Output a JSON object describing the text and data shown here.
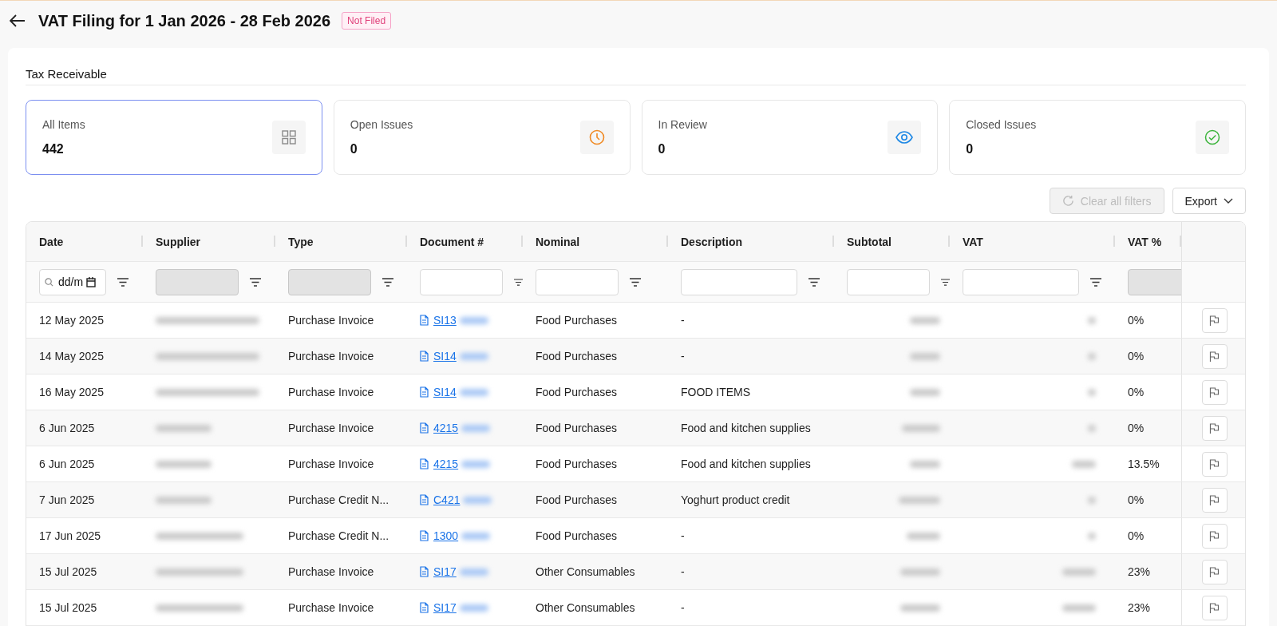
{
  "header": {
    "title": "VAT Filing for 1 Jan 2026 - 28 Feb 2026",
    "status": "Not Filed"
  },
  "section_title": "Tax Receivable",
  "cards": [
    {
      "label": "All Items",
      "count": "442",
      "selected": true,
      "kind": "grid"
    },
    {
      "label": "Open Issues",
      "count": "0",
      "selected": false,
      "kind": "clock"
    },
    {
      "label": "In Review",
      "count": "0",
      "selected": false,
      "kind": "eye"
    },
    {
      "label": "Closed Issues",
      "count": "0",
      "selected": false,
      "kind": "check"
    }
  ],
  "toolbar": {
    "clear_button": {
      "label": "Clear all filters",
      "disabled": true
    },
    "export_button": {
      "label": "Export"
    }
  },
  "table": {
    "columns": [
      "Date",
      "Supplier",
      "Type",
      "Document #",
      "Nominal",
      "Description",
      "Subtotal",
      "VAT",
      "VAT %"
    ],
    "filters": [
      {
        "kind": "date",
        "value": "dd/m",
        "disabled": false
      },
      {
        "kind": "text",
        "disabled": true
      },
      {
        "kind": "text",
        "disabled": true
      },
      {
        "kind": "text",
        "disabled": false
      },
      {
        "kind": "text",
        "disabled": false
      },
      {
        "kind": "text",
        "disabled": false
      },
      {
        "kind": "text",
        "disabled": false
      },
      {
        "kind": "text",
        "disabled": false
      },
      {
        "kind": "text",
        "disabled": true
      }
    ],
    "rows": [
      {
        "date": "12 May 2025",
        "type": "Purchase Invoice",
        "document": "SI13",
        "nominal": "Food Purchases",
        "description": "-",
        "vat_percent": "0%"
      },
      {
        "date": "14 May 2025",
        "type": "Purchase Invoice",
        "document": "SI14",
        "nominal": "Food Purchases",
        "description": "-",
        "vat_percent": "0%"
      },
      {
        "date": "16 May 2025",
        "type": "Purchase Invoice",
        "document": "SI14",
        "nominal": "Food Purchases",
        "description": "FOOD ITEMS",
        "vat_percent": "0%"
      },
      {
        "date": "6 Jun 2025",
        "type": "Purchase Invoice",
        "document": "4215",
        "nominal": "Food Purchases",
        "description": "Food and kitchen supplies",
        "vat_percent": "0%"
      },
      {
        "date": "6 Jun 2025",
        "type": "Purchase Invoice",
        "document": "4215",
        "nominal": "Food Purchases",
        "description": "Food and kitchen supplies",
        "vat_percent": "13.5%"
      },
      {
        "date": "7 Jun 2025",
        "type": "Purchase Credit N...",
        "document": "C421",
        "nominal": "Food Purchases",
        "description": "Yoghurt product credit",
        "vat_percent": "0%"
      },
      {
        "date": "17 Jun 2025",
        "type": "Purchase Credit N...",
        "document": "1300",
        "nominal": "Food Purchases",
        "description": "-",
        "vat_percent": "0%"
      },
      {
        "date": "15 Jul 2025",
        "type": "Purchase Invoice",
        "document": "SI17",
        "nominal": "Other Consumables",
        "description": "-",
        "vat_percent": "23%"
      },
      {
        "date": "15 Jul 2025",
        "type": "Purchase Invoice",
        "document": "SI17",
        "nominal": "Other Consumables",
        "description": "-",
        "vat_percent": "23%"
      }
    ]
  }
}
